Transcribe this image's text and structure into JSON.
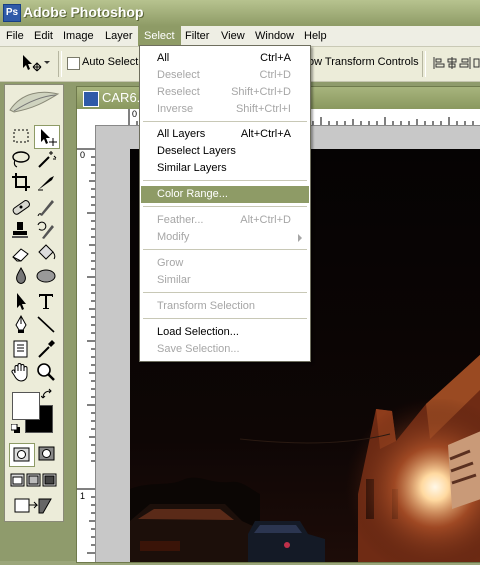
{
  "app": {
    "title": "Adobe Photoshop",
    "logo_text": "Ps"
  },
  "menubar": {
    "items": [
      "File",
      "Edit",
      "Image",
      "Layer",
      "Select",
      "Filter",
      "View",
      "Window",
      "Help"
    ],
    "active": "Select"
  },
  "options_bar": {
    "auto_select_label": "Auto Select L",
    "transform_label": "ow Transform Controls"
  },
  "document": {
    "title": "CAR6.",
    "ruler_top_labels": [
      "0",
      "1"
    ],
    "ruler_left_labels": [
      "0",
      "1"
    ]
  },
  "select_menu": {
    "items": [
      {
        "label": "All",
        "shortcut": "Ctrl+A",
        "enabled": true
      },
      {
        "label": "Deselect",
        "shortcut": "Ctrl+D",
        "enabled": false
      },
      {
        "label": "Reselect",
        "shortcut": "Shift+Ctrl+D",
        "enabled": false
      },
      {
        "label": "Inverse",
        "shortcut": "Shift+Ctrl+I",
        "enabled": false
      },
      {
        "label": "All Layers",
        "shortcut": "Alt+Ctrl+A",
        "enabled": true
      },
      {
        "label": "Deselect Layers",
        "shortcut": "",
        "enabled": true
      },
      {
        "label": "Similar Layers",
        "shortcut": "",
        "enabled": true
      },
      {
        "label": "Color Range...",
        "shortcut": "",
        "enabled": true,
        "highlighted": true
      },
      {
        "label": "Feather...",
        "shortcut": "Alt+Ctrl+D",
        "enabled": false
      },
      {
        "label": "Modify",
        "shortcut": "",
        "enabled": false,
        "submenu": true
      },
      {
        "label": "Grow",
        "shortcut": "",
        "enabled": false
      },
      {
        "label": "Similar",
        "shortcut": "",
        "enabled": false
      },
      {
        "label": "Transform Selection",
        "shortcut": "",
        "enabled": false
      },
      {
        "label": "Load Selection...",
        "shortcut": "",
        "enabled": true
      },
      {
        "label": "Save Selection...",
        "shortcut": "",
        "enabled": false
      }
    ]
  },
  "colors": {
    "accent": "#8e9b66",
    "menu_bg": "#eeeee4",
    "disabled": "#a6a6a6"
  }
}
